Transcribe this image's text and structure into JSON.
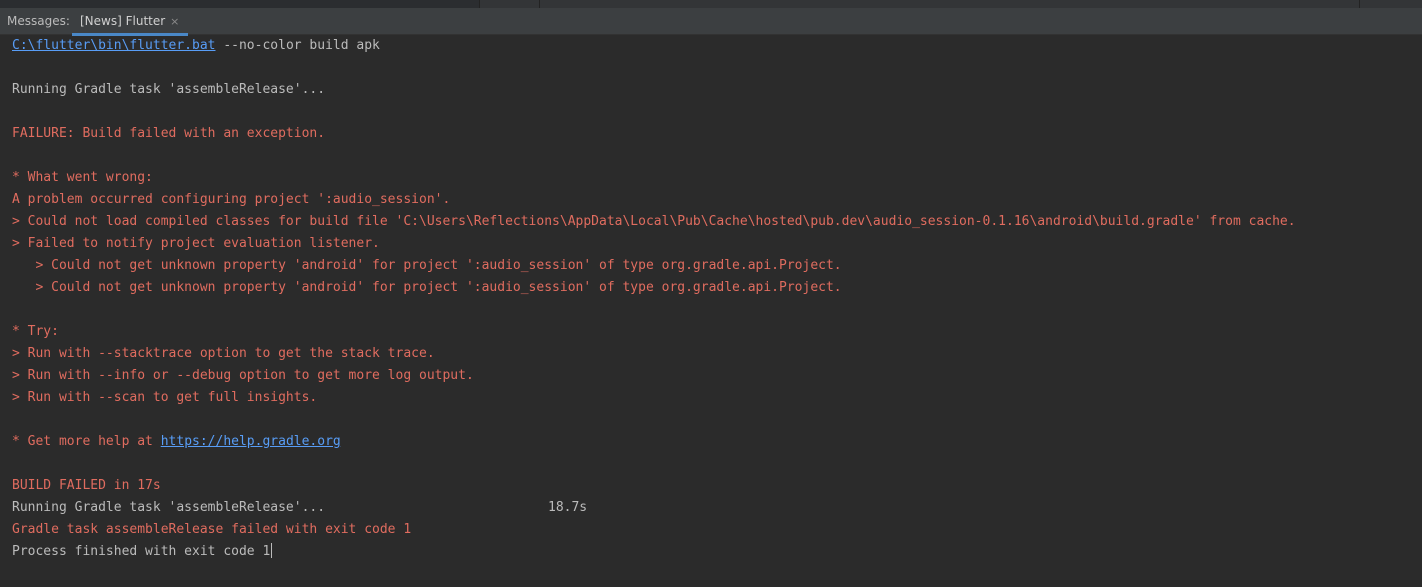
{
  "tabbar": {
    "label": "Messages:",
    "active_tab": "[News] Flutter",
    "close_glyph": "×"
  },
  "console": {
    "command_path": "C:\\flutter\\bin\\flutter.bat",
    "command_args": " --no-color build apk",
    "running_task": "Running Gradle task 'assembleRelease'...",
    "failure": "FAILURE: Build failed with an exception.",
    "what_went_wrong": "* What went wrong:",
    "problem": "A problem occurred configuring project ':audio_session'.",
    "could_not_load": "> Could not load compiled classes for build file 'C:\\Users\\Reflections\\AppData\\Local\\Pub\\Cache\\hosted\\pub.dev\\audio_session-0.1.16\\android\\build.gradle' from cache.",
    "failed_notify": "> Failed to notify project evaluation listener.",
    "unknown_property_1": "   > Could not get unknown property 'android' for project ':audio_session' of type org.gradle.api.Project.",
    "unknown_property_2": "   > Could not get unknown property 'android' for project ':audio_session' of type org.gradle.api.Project.",
    "try": "* Try:",
    "try_stacktrace": "> Run with --stacktrace option to get the stack trace.",
    "try_info": "> Run with --info or --debug option to get more log output.",
    "try_scan": "> Run with --scan to get full insights.",
    "help_prefix": "* Get more help at ",
    "help_link": "https://help.gradle.org",
    "build_failed": "BUILD FAILED in 17s",
    "running_task_timed": "Running Gradle task 'assembleRelease'...",
    "task_time": "18.7s",
    "task_failed": "Gradle task assembleRelease failed with exit code 1",
    "process_finished": "Process finished with exit code 1"
  },
  "colors": {
    "background": "#2b2b2b",
    "text": "#bbbbbb",
    "error": "#e06c5f",
    "link": "#589df6",
    "tab_accent": "#4a88c7"
  }
}
